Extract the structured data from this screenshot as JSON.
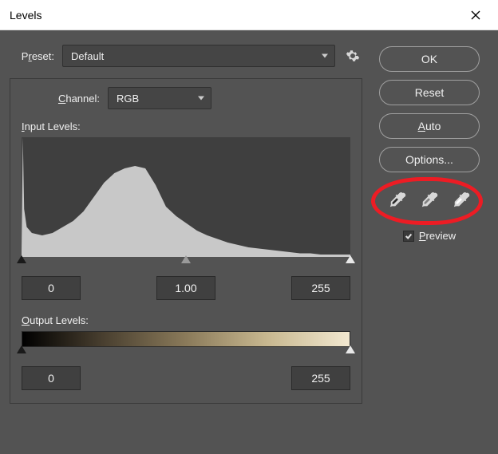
{
  "window": {
    "title": "Levels"
  },
  "preset": {
    "label": "Preset:",
    "label_u": "r",
    "value": "Default"
  },
  "channel": {
    "label": "Channel:",
    "label_u": "C",
    "value": "RGB"
  },
  "input_levels": {
    "label": "Input Levels:",
    "label_u": "I",
    "shadows": "0",
    "midtones": "1.00",
    "highlights": "255"
  },
  "output_levels": {
    "label": "Output Levels:",
    "label_u": "O",
    "low": "0",
    "high": "255"
  },
  "buttons": {
    "ok": "OK",
    "reset": "Reset",
    "auto": "Auto",
    "auto_u": "A",
    "options": "Options..."
  },
  "preview": {
    "label": "Preview",
    "label_u": "P",
    "checked": true
  },
  "eyedroppers": {
    "black": "black-point-eyedropper",
    "gray": "gray-point-eyedropper",
    "white": "white-point-eyedropper"
  },
  "chart_data": {
    "type": "area",
    "title": "",
    "xlabel": "",
    "ylabel": "",
    "xlim": [
      0,
      255
    ],
    "ylim": [
      0,
      100
    ],
    "x": [
      0,
      1,
      2,
      4,
      8,
      16,
      24,
      32,
      40,
      48,
      56,
      64,
      72,
      80,
      88,
      96,
      104,
      112,
      120,
      128,
      136,
      144,
      152,
      160,
      168,
      176,
      184,
      192,
      200,
      208,
      216,
      224,
      232,
      240,
      248,
      255
    ],
    "values": [
      5,
      100,
      40,
      25,
      20,
      18,
      20,
      25,
      30,
      38,
      50,
      62,
      70,
      74,
      76,
      74,
      60,
      42,
      34,
      28,
      22,
      18,
      15,
      12,
      10,
      8,
      7,
      6,
      5,
      4,
      3,
      3,
      2,
      2,
      2,
      2
    ]
  }
}
